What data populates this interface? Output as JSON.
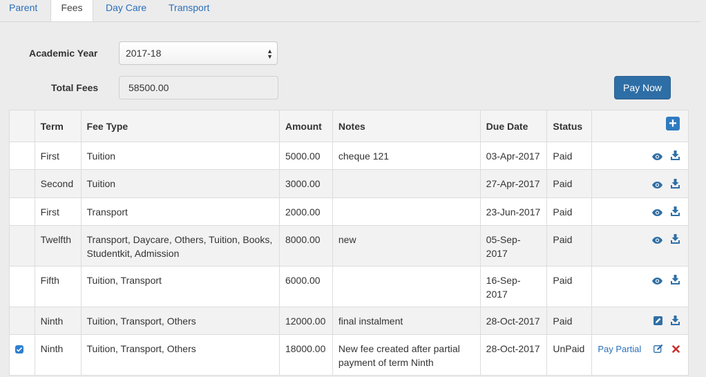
{
  "tabs": [
    "Parent",
    "Fees",
    "Day Care",
    "Transport"
  ],
  "form": {
    "academic_year_label": "Academic Year",
    "academic_year_value": "2017-18",
    "total_fees_label": "Total Fees",
    "total_fees_value": "58500.00",
    "pay_now_label": "Pay Now"
  },
  "table": {
    "headers": [
      "Term",
      "Fee Type",
      "Amount",
      "Notes",
      "Due Date",
      "Status"
    ],
    "rows": [
      {
        "term": "First",
        "fee_type": "Tuition",
        "amount": "5000.00",
        "notes": "cheque 121",
        "due_date": "03-Apr-2017",
        "status": "Paid"
      },
      {
        "term": "Second",
        "fee_type": "Tuition",
        "amount": "3000.00",
        "notes": "",
        "due_date": "27-Apr-2017",
        "status": "Paid"
      },
      {
        "term": "First",
        "fee_type": "Transport",
        "amount": "2000.00",
        "notes": "",
        "due_date": "23-Jun-2017",
        "status": "Paid"
      },
      {
        "term": "Twelfth",
        "fee_type": "Transport, Daycare, Others, Tuition, Books, Studentkit, Admission",
        "amount": "8000.00",
        "notes": "new",
        "due_date": "05-Sep-2017",
        "status": "Paid"
      },
      {
        "term": "Fifth",
        "fee_type": "Tuition, Transport",
        "amount": "6000.00",
        "notes": "",
        "due_date": "16-Sep-2017",
        "status": "Paid"
      },
      {
        "term": "Ninth",
        "fee_type": "Tuition, Transport, Others",
        "amount": "12000.00",
        "notes": "final instalment",
        "due_date": "28-Oct-2017",
        "status": "Paid"
      },
      {
        "term": "Ninth",
        "fee_type": "Tuition, Transport, Others",
        "amount": "18000.00",
        "notes": "New fee created after partial payment of term Ninth",
        "due_date": "28-Oct-2017",
        "status": "UnPaid"
      }
    ],
    "pay_partial_label": "Pay Partial"
  },
  "colors": {
    "accent": "#2e6ea6",
    "link": "#2a6ebb",
    "delete": "#c9302c"
  }
}
